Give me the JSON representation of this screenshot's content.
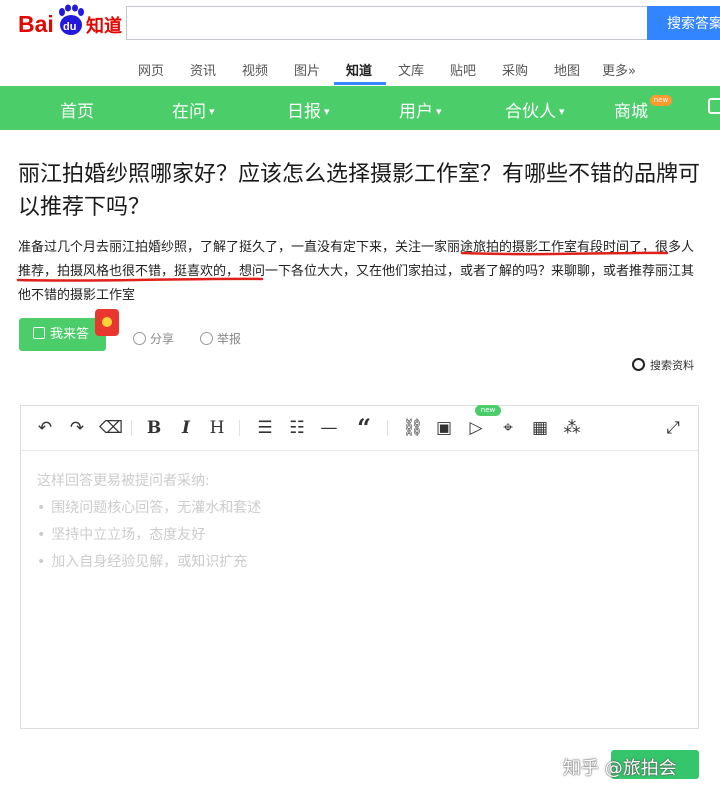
{
  "header": {
    "logo_text": "Bai",
    "logo_du": "du",
    "logo_zhidao": "知道",
    "search_placeholder": "",
    "search_button": "搜索答案"
  },
  "product_nav": [
    "网页",
    "资讯",
    "视频",
    "图片",
    "知道",
    "文库",
    "贴吧",
    "采购",
    "地图",
    "更多»"
  ],
  "product_nav_active": "知道",
  "main_nav": {
    "items": [
      "首页",
      "在问",
      "日报",
      "用户",
      "合伙人",
      "商城"
    ],
    "dropdown_items": [
      "在问",
      "日报",
      "用户",
      "合伙人"
    ],
    "badge": "new",
    "color": "#4bce6a"
  },
  "question": {
    "title": "丽江拍婚纱照哪家好？应该怎么选择摄影工作室？有哪些不错的品牌可以推荐下吗？",
    "description": "准备过几个月去丽江拍婚纱照，了解了挺久了，一直没有定下来，关注一家丽途旅拍的摄影工作室有段时间了，很多人推荐，拍摄风格也很不错，挺喜欢的，想问一下各位大大，又在他们家拍过，或者了解的吗？来聊聊，或者推荐丽江其他不错的摄影工作室"
  },
  "actions": {
    "answer": "我来答",
    "share": "分享",
    "report": "举报",
    "search_material": "搜索资料"
  },
  "editor": {
    "toolbar_badge": "new",
    "placeholder_title": "这样回答更易被提问者采纳:",
    "placeholder_points": [
      "围绕问题核心回答，无灌水和套述",
      "坚持中立立场，态度友好",
      "加入自身经验见解，或知识扩充"
    ]
  },
  "watermark": "知乎 @旅拍会",
  "colors": {
    "brand_blue": "#3385ff",
    "green": "#4bce6a",
    "red_underline": "#e0201a"
  }
}
